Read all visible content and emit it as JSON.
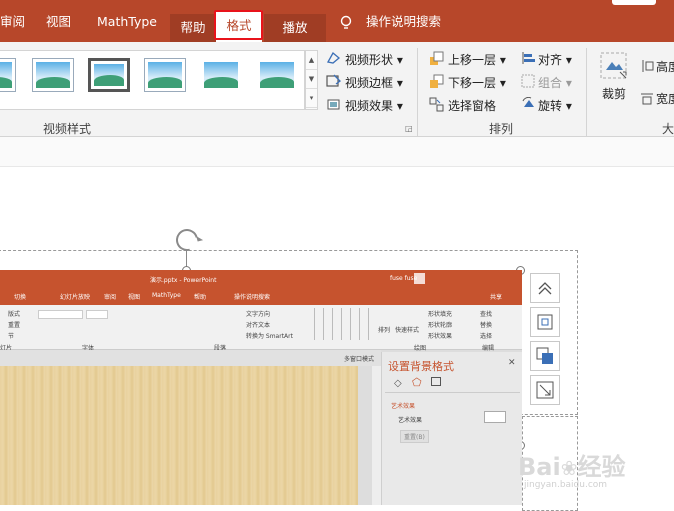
{
  "tabs": {
    "review": "审阅",
    "view": "视图",
    "mathtype": "MathType",
    "help": "帮助",
    "format": "格式",
    "playback": "播放",
    "tell_me": "操作说明搜索"
  },
  "ribbon": {
    "video_shape": "视频形状",
    "video_border": "视频边框",
    "video_effects": "视频效果",
    "bring_forward": "上移一层",
    "send_backward": "下移一层",
    "selection_pane": "选择窗格",
    "align": "对齐",
    "group": "组合",
    "rotate": "旋转",
    "crop": "裁剪",
    "height": "高度",
    "width": "宽度",
    "size_partial": "大",
    "group_video_styles": "视频样式",
    "group_arrange": "排列"
  },
  "inner": {
    "title": "演示.pptx - PowerPoint",
    "user": "fuse fuse",
    "share": "共享",
    "tabs": [
      "切换",
      "幻灯片放映",
      "审阅",
      "视图",
      "MathType",
      "帮助",
      "操作说明搜索"
    ],
    "group_font": "字体",
    "group_paragraph": "段落",
    "group_drawing": "绘图",
    "group_editing": "编辑",
    "pane_title": "设置背景格式",
    "pane_section": "艺术效果",
    "pane_label": "艺术效果",
    "pane_reset": "重置(B)",
    "ui_labels": [
      "版式",
      "重置",
      "节",
      "灯片",
      "文字方向",
      "对齐文本",
      "转换为 SmartArt",
      "排列",
      "快速样式",
      "形状填充",
      "形状轮廓",
      "形状效果",
      "查找",
      "替换",
      "选择",
      "多窗口模式"
    ]
  },
  "watermark": {
    "brand": "Bai",
    "brand2": "经验",
    "url": "jingyan.baidu.com"
  },
  "colors": {
    "accent": "#b7472a",
    "highlight": "#e8131b",
    "pane_title": "#c6532e"
  }
}
